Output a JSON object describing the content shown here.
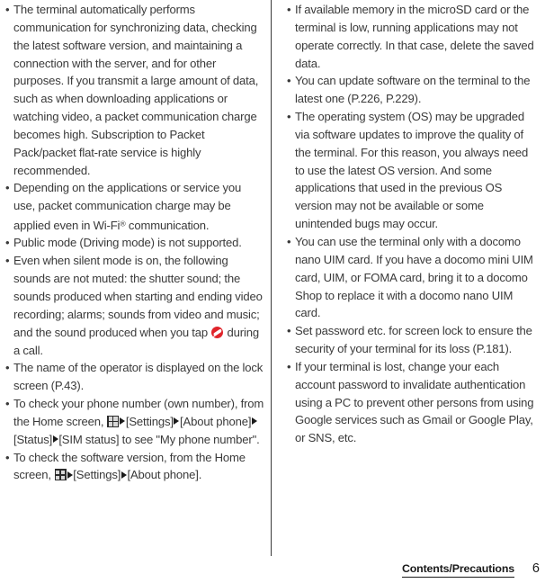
{
  "document": {
    "page_number": "6",
    "footer_section_title": "Contents/Precautions"
  },
  "icons": {
    "app_drawer": "app-drawer-grid-icon",
    "end_call": "end-call-icon",
    "arrow": "right-triangle-arrow-icon",
    "bullet": "•"
  },
  "columns": {
    "left": {
      "bullets": [
        {
          "id": "bullet-auto-communication",
          "segments": [
            {
              "type": "text",
              "value": "The terminal automatically performs communication for synchronizing data, checking the latest software version, and maintaining a connection with the server, and for other purposes. If you transmit a large amount of data, such as when downloading applications or watching video, a packet communication charge becomes high. Subscription to Packet Pack/packet flat-rate service is highly recommended."
            }
          ]
        },
        {
          "id": "bullet-wifi-charge",
          "segments": [
            {
              "type": "text",
              "value": "Depending on the applications or service you use, packet communication charge may be applied even in Wi-Fi"
            },
            {
              "type": "sup",
              "value": "®"
            },
            {
              "type": "text",
              "value": " communication."
            }
          ]
        },
        {
          "id": "bullet-public-mode",
          "segments": [
            {
              "type": "text",
              "value": "Public mode (Driving mode) is not supported."
            }
          ]
        },
        {
          "id": "bullet-silent-mode",
          "segments": [
            {
              "type": "text",
              "value": "Even when silent mode is on, the following sounds are not muted: the shutter sound; the sounds produced when starting and ending video recording; alarms; sounds from video and music; and the sound produced when you tap "
            },
            {
              "type": "icon",
              "value": "end-call-icon"
            },
            {
              "type": "text",
              "value": " during a call."
            }
          ]
        },
        {
          "id": "bullet-operator-name",
          "segments": [
            {
              "type": "text",
              "value": "The name of the operator is displayed on the lock screen (P.43)."
            }
          ]
        },
        {
          "id": "bullet-own-number",
          "segments": [
            {
              "type": "text",
              "value": "To check your phone number (own number), from the Home screen, "
            },
            {
              "type": "icon",
              "value": "app-drawer-grid-icon"
            },
            {
              "type": "icon",
              "value": "right-triangle-arrow-icon"
            },
            {
              "type": "text",
              "value": "[Settings]"
            },
            {
              "type": "icon",
              "value": "right-triangle-arrow-icon"
            },
            {
              "type": "text",
              "value": "[About phone]"
            },
            {
              "type": "icon",
              "value": "right-triangle-arrow-icon"
            },
            {
              "type": "text",
              "value": "[Status]"
            },
            {
              "type": "icon",
              "value": "right-triangle-arrow-icon"
            },
            {
              "type": "text",
              "value": "[SIM status] to see \"My phone number\"."
            }
          ]
        },
        {
          "id": "bullet-software-version",
          "segments": [
            {
              "type": "text",
              "value": "To check the software version, from the Home screen, "
            },
            {
              "type": "icon",
              "value": "app-drawer-grid-icon"
            },
            {
              "type": "icon",
              "value": "right-triangle-arrow-icon"
            },
            {
              "type": "text",
              "value": "[Settings]"
            },
            {
              "type": "icon",
              "value": "right-triangle-arrow-icon"
            },
            {
              "type": "text",
              "value": "[About phone]."
            }
          ]
        }
      ]
    },
    "right": {
      "bullets": [
        {
          "id": "bullet-microsd-memory",
          "segments": [
            {
              "type": "text",
              "value": "If available memory in the microSD card or the terminal is low, running applications may not operate correctly. In that case, delete the saved data."
            }
          ]
        },
        {
          "id": "bullet-update-software",
          "segments": [
            {
              "type": "text",
              "value": "You can update software on the terminal to the latest one (P.226, P.229)."
            }
          ]
        },
        {
          "id": "bullet-os-upgrade",
          "segments": [
            {
              "type": "text",
              "value": "The operating system (OS) may be upgraded via software updates to improve the quality of the terminal. For this reason, you always need to use the latest OS version. And some applications that used in the previous OS version may not be available or some unintended bugs may occur."
            }
          ]
        },
        {
          "id": "bullet-nano-uim",
          "segments": [
            {
              "type": "text",
              "value": "You can use the terminal only with a docomo nano UIM card. If you have a docomo mini UIM card, UIM, or FOMA card, bring it to a docomo Shop to replace it with a docomo nano UIM card."
            }
          ]
        },
        {
          "id": "bullet-screen-lock-password",
          "segments": [
            {
              "type": "text",
              "value": "Set password etc. for screen lock to ensure the security of your terminal for its loss (P.181)."
            }
          ]
        },
        {
          "id": "bullet-lost-terminal",
          "segments": [
            {
              "type": "text",
              "value": "If your terminal is lost, change your each account password to invalidate authentication using a PC to prevent other persons from using Google services such as Gmail or Google Play, or SNS, etc."
            }
          ]
        }
      ]
    }
  },
  "colors": {
    "text": "#3a3a3a",
    "footer_text": "#1a1a1a",
    "divider": "#3a3a3a",
    "end_call_red": "#e0242b",
    "grid_icon_dark": "#2b2b2b",
    "grid_icon_light": "#d8d8d8",
    "background": "#ffffff"
  }
}
